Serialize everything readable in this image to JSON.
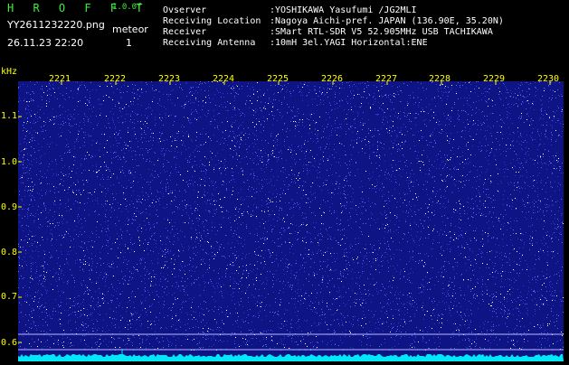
{
  "header": {
    "brand": "H R O F F T",
    "version": "1.0.0f",
    "filename": "YY2611232220.png",
    "timestamp": "26.11.23 22:20",
    "counter_label": "meteor",
    "counter_value": "1"
  },
  "station": {
    "labels": [
      "Ovserver",
      "Receiving Location",
      "Receiver",
      "Receiving Antenna"
    ],
    "values": [
      ":YOSHIKAWA Yasufumi /JG2MLI",
      ":Nagoya Aichi-pref. JAPAN (136.90E, 35.20N)",
      ":SMart RTL-SDR V5 52.905MHz USB TACHIKAWA",
      ":10mH 3el.YAGI Horizontal:ENE"
    ]
  },
  "spectrogram": {
    "y_unit": "kHz",
    "y_ticks": [
      "1.1",
      "1.0",
      "0.9",
      "0.8",
      "0.7",
      "0.6"
    ],
    "x_ticks": [
      "2221",
      "2222",
      "2223",
      "2224",
      "2225",
      "2226",
      "2227",
      "2228",
      "2229",
      "2230"
    ],
    "colors": {
      "background": "#0e1484",
      "noise_low": "#2a3ad8",
      "noise_high": "#ffffff",
      "trace": "#00e8f8",
      "tick": "#ffff00",
      "reference_line": "#b8b8ff"
    }
  }
}
